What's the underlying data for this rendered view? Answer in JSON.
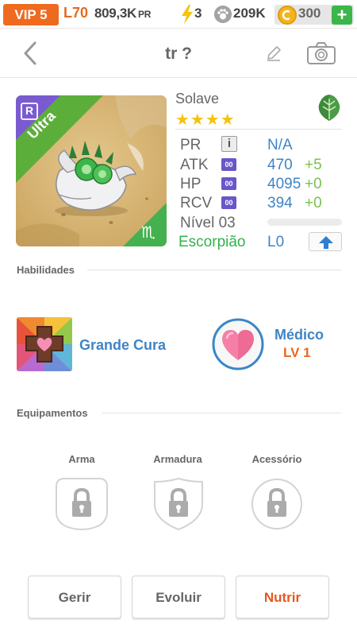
{
  "status_bar": {
    "vip": "VIP 5",
    "level": "L70",
    "pr_amount": "809,3K",
    "pr_unit": "PR",
    "energy": "3",
    "paw": "209K",
    "coins": "300",
    "plus": "+"
  },
  "header": {
    "title": "tr ?"
  },
  "monster": {
    "rarity": "Ultra",
    "rank_badge": "R",
    "name": "Solave",
    "stars": "★★★★",
    "stats": {
      "pr_label": "PR",
      "pr_info": "i",
      "pr_value": "N/A",
      "atk_label": "ATK",
      "atk_badge": "00",
      "atk_value": "470",
      "atk_bonus": "+5",
      "hp_label": "HP",
      "hp_badge": "00",
      "hp_value": "4095",
      "hp_bonus": "+0",
      "rcv_label": "RCV",
      "rcv_badge": "00",
      "rcv_value": "394",
      "rcv_bonus": "+0",
      "level_label": "Nível 03",
      "level_progress": 0
    },
    "zodiac": {
      "name": "Escorpião",
      "level": "L0",
      "symbol": "♏"
    }
  },
  "abilities": {
    "section_title": "Habilidades",
    "skill_name": "Grande Cura",
    "leader_name": "Médico",
    "leader_level": "LV 1"
  },
  "equipment": {
    "section_title": "Equipamentos",
    "slots": [
      {
        "label": "Arma"
      },
      {
        "label": "Armadura"
      },
      {
        "label": "Acessório"
      }
    ]
  },
  "actions": {
    "manage": "Gerir",
    "evolve": "Evoluir",
    "feed": "Nutrir"
  },
  "colors": {
    "accent_orange": "#ef6a1f",
    "value_blue": "#3f84c6",
    "bonus_green": "#7ac24c",
    "zodiac_green": "#34b14c"
  }
}
